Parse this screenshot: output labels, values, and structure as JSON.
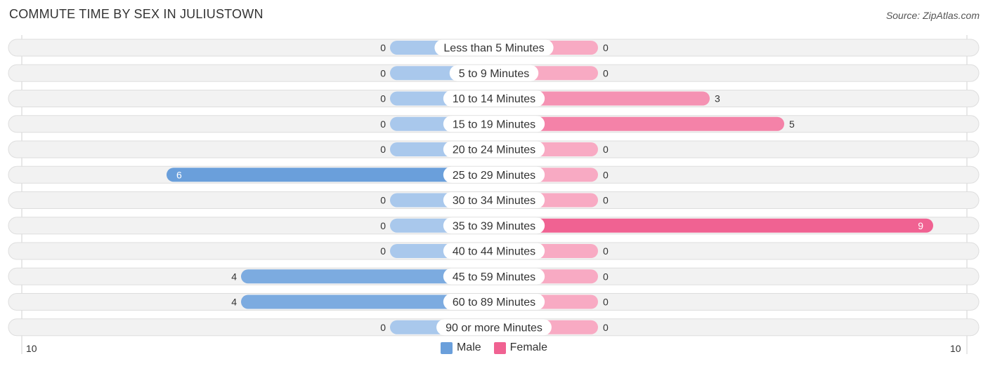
{
  "header": {
    "title": "COMMUTE TIME BY SEX IN JULIUSTOWN",
    "source": "Source: ZipAtlas.com"
  },
  "legend": {
    "male_label": "Male",
    "female_label": "Female"
  },
  "axis": {
    "left_label": "10",
    "right_label": "10"
  },
  "colors": {
    "male_strong": "#6a9fdb",
    "male_light": "#a9c8ec",
    "female_strong": "#f06292",
    "female_light": "#f8aac3",
    "row_bg": "#f2f2f2"
  },
  "chart_data": {
    "type": "bar",
    "title": "COMMUTE TIME BY SEX IN JULIUSTOWN",
    "orientation": "horizontal-diverging",
    "categories": [
      "Less than 5 Minutes",
      "5 to 9 Minutes",
      "10 to 14 Minutes",
      "15 to 19 Minutes",
      "20 to 24 Minutes",
      "25 to 29 Minutes",
      "30 to 34 Minutes",
      "35 to 39 Minutes",
      "40 to 44 Minutes",
      "45 to 59 Minutes",
      "60 to 89 Minutes",
      "90 or more Minutes"
    ],
    "series": [
      {
        "name": "Male",
        "values": [
          0,
          0,
          0,
          0,
          0,
          6,
          0,
          0,
          0,
          4,
          4,
          0
        ]
      },
      {
        "name": "Female",
        "values": [
          0,
          0,
          3,
          5,
          0,
          0,
          0,
          9,
          0,
          0,
          0,
          0
        ]
      }
    ],
    "xlim": [
      -10,
      10
    ],
    "xlabel": "",
    "ylabel": "",
    "legend_position": "bottom-center",
    "grid": false
  }
}
